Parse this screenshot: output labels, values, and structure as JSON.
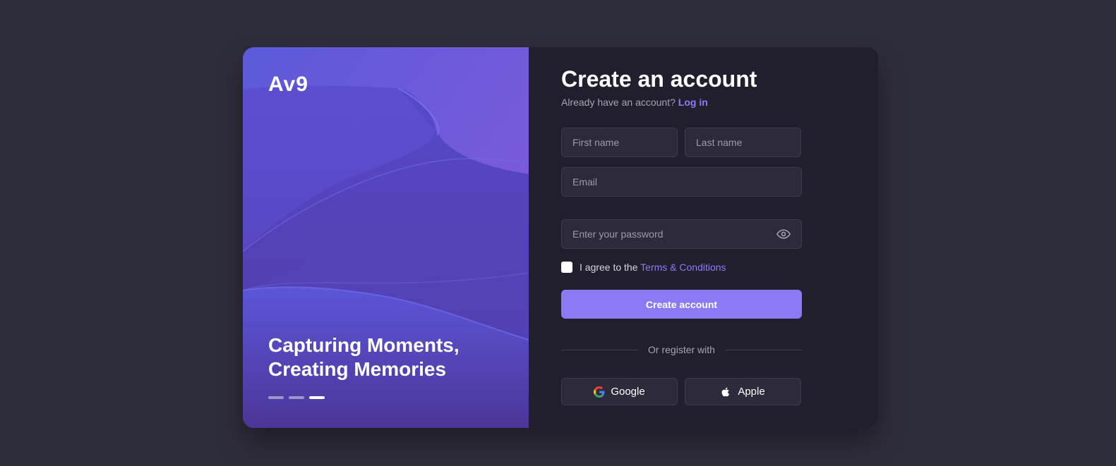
{
  "hero": {
    "logo": "Av9",
    "tagline_line1": "Capturing Moments,",
    "tagline_line2": "Creating Memories",
    "slides_total": 3,
    "slide_active_index": 2
  },
  "form": {
    "title": "Create an account",
    "subtitle_text": "Already have an account?",
    "login_link": "Log in",
    "first_name_placeholder": "First name",
    "last_name_placeholder": "Last name",
    "email_placeholder": "Email",
    "password_placeholder": "Enter your password",
    "agree_text": "I agree to the",
    "terms_link": "Terms & Conditions",
    "agree_checked": false,
    "submit_label": "Create account",
    "divider_text": "Or register with",
    "google_label": "Google",
    "apple_label": "Apple"
  },
  "icons": {
    "password_toggle": "eye-icon",
    "google": "google-icon",
    "apple": "apple-icon"
  },
  "colors": {
    "accent": "#8a7af6",
    "link": "#8b7cf6",
    "panel_bg": "#211f2e",
    "page_bg": "#2e2d3a",
    "input_bg": "#2d2b3b"
  }
}
